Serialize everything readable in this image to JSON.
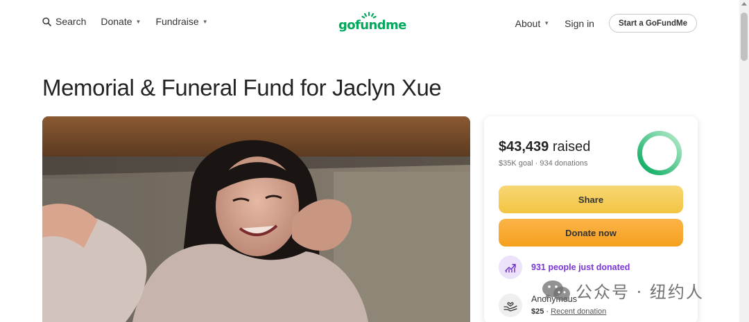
{
  "header": {
    "search_label": "Search",
    "donate_label": "Donate",
    "fundraise_label": "Fundraise",
    "logo_text": "gofundme",
    "about_label": "About",
    "signin_label": "Sign in",
    "start_label": "Start a GoFundMe"
  },
  "page": {
    "title": "Memorial & Funeral Fund for Jaclyn Xue"
  },
  "card": {
    "raised_amount": "$43,439",
    "raised_word": "raised",
    "goal": "$35K goal",
    "separator": "·",
    "donation_count": "934 donations",
    "progress_fraction": 1.0,
    "share_label": "Share",
    "donate_label": "Donate now",
    "trend_text": "931 people just donated",
    "donor_name": "Anonymous",
    "donor_amount": "$25",
    "donor_dot": "·",
    "donor_recent": "Recent donation"
  },
  "watermark": {
    "text": "公众号 · 纽约人"
  },
  "colors": {
    "brand_green": "#02a95c",
    "share_yellow": "#f2c442",
    "donate_orange": "#f5a01e",
    "trend_purple": "#7a34d9"
  },
  "icons": {
    "search": "search-icon",
    "caret": "chevron-down-icon",
    "trend": "trending-up-icon",
    "donor": "hands-heart-icon",
    "watermark": "wechat-icon"
  }
}
